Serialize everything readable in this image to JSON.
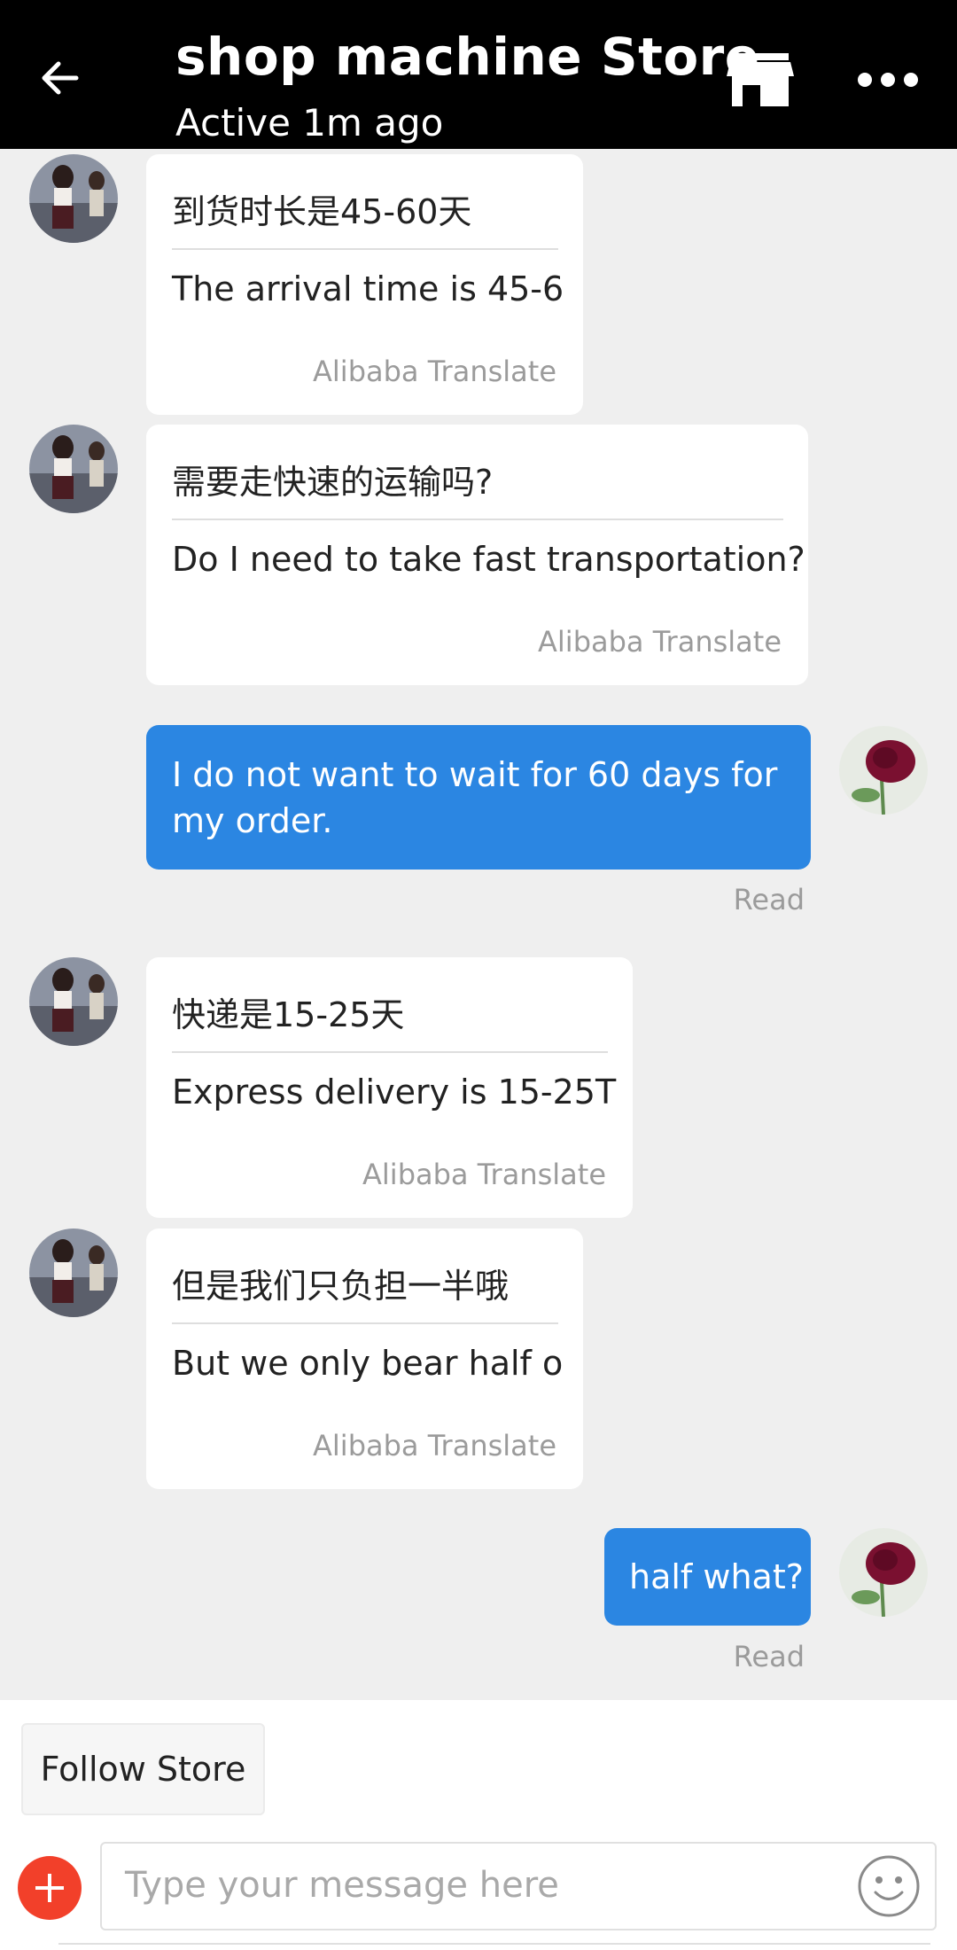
{
  "header": {
    "title": "shop machine Store",
    "subtitle": "Active 1m ago",
    "icons": [
      "back-arrow-icon",
      "store-icon",
      "more-icon"
    ]
  },
  "messages": [
    {
      "from": "shop",
      "original": "到货时长是45-60天",
      "translation": "The arrival time is 45-6",
      "credit": "Alibaba Translate"
    },
    {
      "from": "shop",
      "original": "需要走快速的运输吗?",
      "translation": "Do I need to take fast transportation?",
      "credit": "Alibaba Translate"
    },
    {
      "from": "me",
      "text": "I do not want to wait for 60 days for my order.",
      "status": "Read"
    },
    {
      "from": "shop",
      "original": "快递是15-25天",
      "translation": "Express delivery is 15-25T",
      "credit": "Alibaba Translate"
    },
    {
      "from": "shop",
      "original": "但是我们只负担一半哦",
      "translation": "But we only bear half o",
      "credit": "Alibaba Translate"
    },
    {
      "from": "me",
      "text": "half what?",
      "status": "Read"
    }
  ],
  "bottom": {
    "follow_label": "Follow Store",
    "input_placeholder": "Type your message here"
  },
  "colors": {
    "header_bg": "#000000",
    "outgoing_bubble": "#2b86e2",
    "chat_bg": "#efefef",
    "plus_button": "#f2402a"
  }
}
